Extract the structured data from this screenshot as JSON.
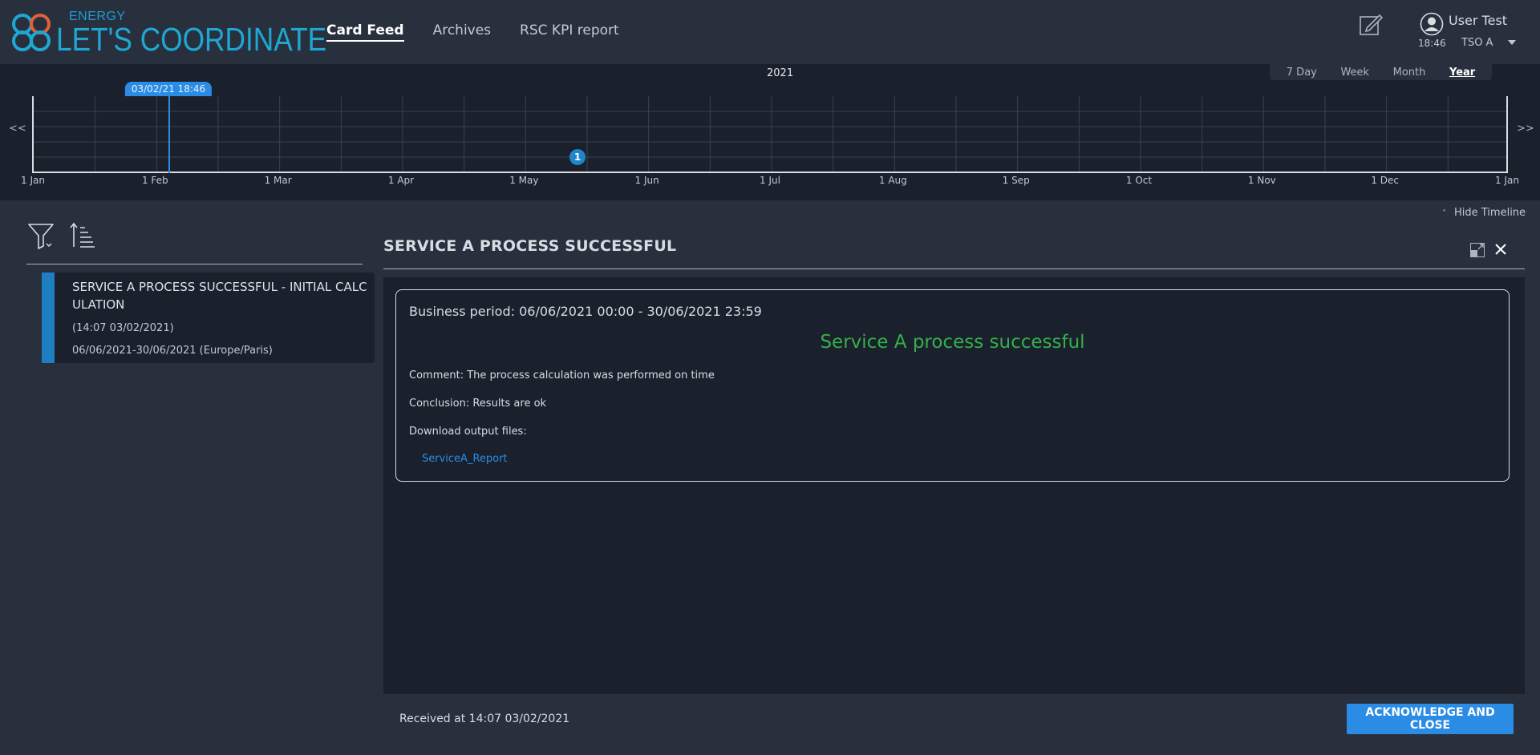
{
  "header": {
    "logo_brand": "ENERGY",
    "logo_title": "LET'S COORDINATE",
    "nav": [
      "Card Feed",
      "Archives",
      "RSC KPI report"
    ],
    "active_nav": "Card Feed",
    "user_name": "User Test",
    "time": "18:46",
    "entity": "TSO A",
    "icons": {
      "edit": "edit-icon",
      "user": "user-icon",
      "caret": "caret-down-icon"
    },
    "colors": {
      "logo": "#1fa7d4",
      "logo_rings": "#e0603a"
    }
  },
  "timeline": {
    "year": "2021",
    "periods": [
      "7 Day",
      "Week",
      "Month",
      "Year"
    ],
    "active_period": "Year",
    "prev": "<<",
    "next": ">>",
    "x_labels": [
      "1 Jan",
      "1 Feb",
      "1 Mar",
      "1 Apr",
      "1 May",
      "1 Jun",
      "1 Jul",
      "1 Aug",
      "1 Sep",
      "1 Oct",
      "1 Nov",
      "1 Dec",
      "1 Jan"
    ],
    "now_label": "03/02/21 18:46",
    "card_count": "1",
    "hide_label": "Hide Timeline",
    "colors": {
      "now_marker": "#2b8ce6",
      "card_marker": "#1e87c8"
    }
  },
  "feed": {
    "icons": {
      "filter": "filter-icon",
      "sort": "sort-icon"
    },
    "card": {
      "title": "SERVICE A PROCESS SUCCESSFUL - INITIAL CALCULATION",
      "time": "(14:07 03/02/2021)",
      "range": "06/06/2021-30/06/2021 (Europe/Paris)",
      "color": "#1e7fc0"
    }
  },
  "detail": {
    "title": "SERVICE A PROCESS SUCCESSFUL",
    "business_period": "Business period: 06/06/2021 00:00 - 30/06/2021 23:59",
    "status": "Service A process successful",
    "comment": "Comment: The process calculation was performed on time",
    "conclusion": "Conclusion: Results are ok",
    "download_label": "Download output files:",
    "file": "ServiceA_Report",
    "received": "Received at 14:07 03/02/2021",
    "ack_button": "ACKNOWLEDGE AND CLOSE",
    "colors": {
      "status": "#35b04a",
      "link": "#2b8ce6",
      "button": "#2b8ce6"
    }
  }
}
